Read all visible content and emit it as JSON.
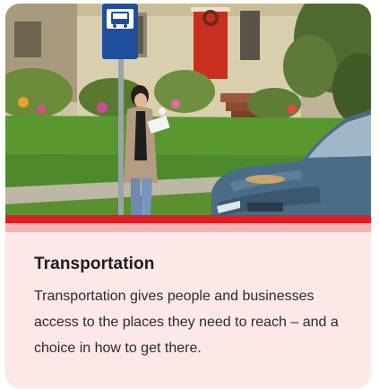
{
  "card": {
    "title": "Transportation",
    "description": "Transportation gives people and businesses access to the places they need to reach – and a choice in how to get there.",
    "image_alt": "Person standing at a bus stop sign on a residential street next to a parked car",
    "accent_color": "#e31b23",
    "accent_light_color": "#f7b2b2",
    "background_color": "#fde8e8"
  }
}
